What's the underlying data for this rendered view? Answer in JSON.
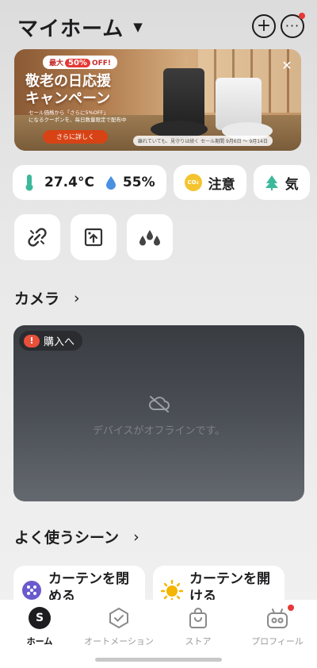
{
  "header": {
    "title": "マイホーム",
    "caret_icon": "caret-down-icon",
    "add_icon": "plus-circle-icon",
    "more_icon": "more-circle-icon"
  },
  "banner": {
    "discount_prefix": "最大",
    "discount_value": "50%",
    "discount_suffix": "OFF!",
    "title_line1": "敬老の日応援",
    "title_line2": "キャンペーン",
    "sub_line1": "セール価格から「さらに5%OFF」",
    "sub_line2": "になるクーポンを、毎日数量限定で配布中",
    "button_label": "さらに詳しく",
    "note": "離れていても、見守りは続く  セール期間 9月6日 ～ 9月14日"
  },
  "environment": {
    "temperature": "27.4°C",
    "humidity": "55%",
    "co2_label": "CO₂",
    "co2_status": "注意",
    "air_label": "気"
  },
  "sections": {
    "camera": "カメラ",
    "scenes": "よく使うシーン"
  },
  "camera": {
    "buy_label": "購入へ",
    "offline_text": "デバイスがオフラインです。"
  },
  "scenes": [
    {
      "label": "カーテンを閉める",
      "icon": "dots-circle-icon"
    },
    {
      "label": "カーテンを開ける",
      "icon": "sun-icon"
    }
  ],
  "tabs": [
    {
      "label": "ホーム",
      "icon": "home-avatar-icon",
      "avatar_letter": "S",
      "active": true
    },
    {
      "label": "オートメーション",
      "icon": "automation-check-icon",
      "active": false
    },
    {
      "label": "ストア",
      "icon": "store-bag-icon",
      "active": false
    },
    {
      "label": "プロフィール",
      "icon": "robot-face-icon",
      "active": false
    }
  ],
  "colors": {
    "accent_red": "#e53935",
    "camera_bg": "#3d4046",
    "scene_purple": "#6a5acd",
    "sun_yellow": "#f5b400"
  }
}
